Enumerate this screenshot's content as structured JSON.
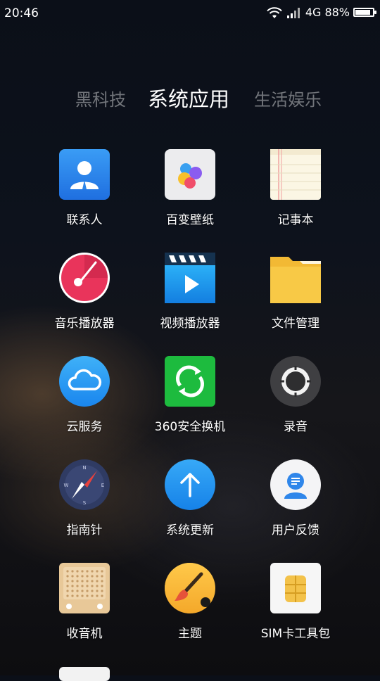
{
  "status_bar": {
    "time": "20:46",
    "network": "4G",
    "battery": "88%",
    "battery_level": 0.88
  },
  "tabs": [
    {
      "label": "黑科技",
      "active": false
    },
    {
      "label": "系统应用",
      "active": true
    },
    {
      "label": "生活娱乐",
      "active": false
    }
  ],
  "apps": [
    {
      "label": "联系人",
      "icon": "contacts-icon"
    },
    {
      "label": "百变壁纸",
      "icon": "wallpaper-icon"
    },
    {
      "label": "记事本",
      "icon": "notepad-icon"
    },
    {
      "label": "音乐播放器",
      "icon": "music-player-icon"
    },
    {
      "label": "视频播放器",
      "icon": "video-player-icon"
    },
    {
      "label": "文件管理",
      "icon": "folder-icon"
    },
    {
      "label": "云服务",
      "icon": "cloud-icon"
    },
    {
      "label": "360安全换机",
      "icon": "phone-transfer-icon"
    },
    {
      "label": "录音",
      "icon": "recorder-icon"
    },
    {
      "label": "指南针",
      "icon": "compass-icon"
    },
    {
      "label": "系统更新",
      "icon": "system-update-icon"
    },
    {
      "label": "用户反馈",
      "icon": "feedback-icon"
    },
    {
      "label": "收音机",
      "icon": "radio-icon"
    },
    {
      "label": "主题",
      "icon": "theme-icon"
    },
    {
      "label": "SIM卡工具包",
      "icon": "sim-card-icon"
    }
  ]
}
